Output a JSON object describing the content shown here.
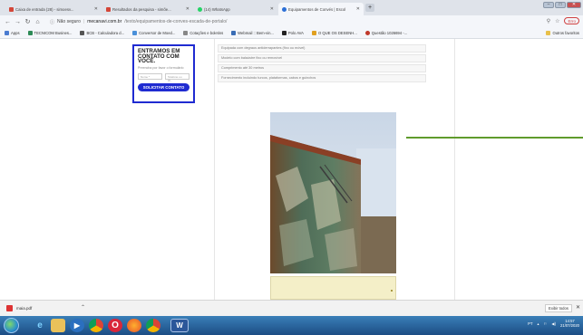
{
  "browser": {
    "tabs": [
      {
        "title": "Caixa de entrada (28) - simoesv...",
        "icon": "gmail-icon",
        "active": false
      },
      {
        "title": "Resultados da pesquisa - simõe...",
        "icon": "gmail-icon",
        "active": false
      },
      {
        "title": "(14) WhatsApp",
        "icon": "whatsapp-icon",
        "active": false
      },
      {
        "title": "Equipamentos de Convés | Escol",
        "icon": "mecanavi-icon",
        "active": true
      }
    ],
    "new_tab_label": "+",
    "address": {
      "security_label": "Não seguro",
      "host": "mecanavi.com.br",
      "path": "/texto/equipamentos-de-conves-escada-de-portalo/"
    },
    "profile_label": "Erro",
    "bookmarks": [
      {
        "label": "Apps",
        "color": "#4a7bd0"
      },
      {
        "label": "TECNICOM Busines...",
        "color": "#2e8b57"
      },
      {
        "label": "BCB - Calculadora d...",
        "color": "#555555"
      },
      {
        "label": "Conversor de Moed...",
        "color": "#4a90d9"
      },
      {
        "label": "Cotações e boletins",
        "color": "#888888"
      },
      {
        "label": "Webmail :: Bem-vin...",
        "color": "#3a6db5"
      },
      {
        "label": "Polo AVA",
        "color": "#222222"
      },
      {
        "label": "O QUE OS DESENH...",
        "color": "#e0a020"
      },
      {
        "label": "Questão 1026694 -...",
        "color": "#c0392b"
      }
    ],
    "other_bookmarks": "Outros favoritos"
  },
  "page": {
    "form": {
      "title": "ENTRAMOS EM CONTATO COM VOCÊ.",
      "subtitle": "Preencha por favor o formulário",
      "name_placeholder": "Nome *",
      "phone_placeholder": "Telefone ou W...",
      "submit_label": "SOLICITAR CONTATO"
    },
    "spec_list": [
      "Equipada com degraus antiderrapantes (fixo ou móvel)",
      "Modelo com balaústre fixo ou removível",
      "Comprimento até 30 metros",
      "Fornecimento incluindo turcos, plataformas, cabos e guinchos"
    ]
  },
  "downloads": {
    "file_name": "maia.pdf",
    "show_all_label": "Exibir todos"
  },
  "taskbar": {
    "apps": [
      "ie-icon",
      "folder-icon",
      "media-player-icon",
      "chrome-icon",
      "opera-icon",
      "firefox-icon",
      "chrome-icon",
      "word-icon"
    ],
    "language": "PT",
    "time": "14:57",
    "date": "21/07/2020"
  },
  "colors": {
    "form_accent": "#1f2bd1",
    "green_line": "#5f9b2c"
  }
}
